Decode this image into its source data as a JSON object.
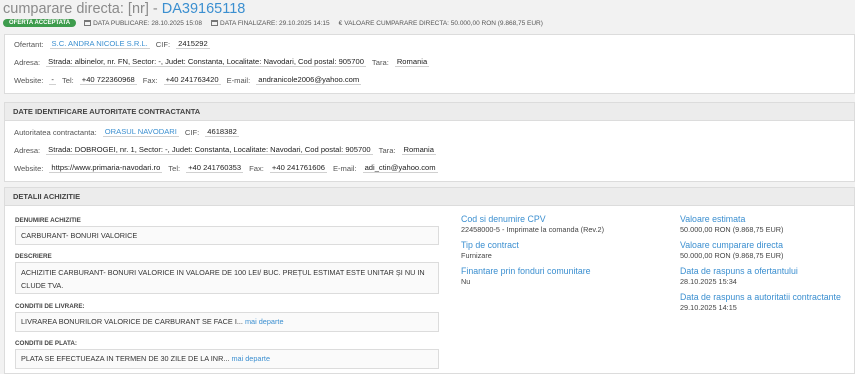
{
  "header": {
    "title_prefix": "cumparare directa: [nr] - ",
    "title_code": "DA39165118",
    "badge": "OFERTA ACCEPTATA",
    "data_publicare": "DATA PUBLICARE: 28.10.2025 15:08",
    "data_finalizare": "DATA FINALIZARE: 29.10.2025 14:15",
    "valoare": "VALOARE CUMPARARE DIRECTA: 50.000,00   RON (9.868,75  EUR)"
  },
  "ofertant": {
    "label_ofertant": "Ofertant:",
    "name": "S.C. ANDRA NICOLE S.R.L.",
    "label_cif": "CIF:",
    "cif": "2415292",
    "label_adresa": "Adresa:",
    "adresa": "Strada: albinelor, nr. FN, Sector: -, Judet: Constanta, Localitate: Navodari, Cod postal: 905700",
    "label_tara": "Tara:",
    "tara": "Romania",
    "label_website": "Website:",
    "website": "-",
    "label_tel": "Tel:",
    "tel": "+40 722360968",
    "label_fax": "Fax:",
    "fax": "+40 241763420",
    "label_email": "E-mail:",
    "email": "andranicole2006@yahoo.com"
  },
  "autoritate": {
    "section_title": "DATE IDENTIFICARE AUTORITATE CONTRACTANTA",
    "label_autoritate": "Autoritatea contractanta:",
    "name": "ORASUL NAVODARI",
    "label_cif": "CIF:",
    "cif": "4618382",
    "label_adresa": "Adresa:",
    "adresa": "Strada: DOBROGEI, nr. 1, Sector: -, Judet: Constanta, Localitate: Navodari, Cod postal: 905700",
    "label_tara": "Tara:",
    "tara": "Romania",
    "label_website": "Website:",
    "website": "https://www.primaria-navodari.ro",
    "label_tel": "Tel:",
    "tel": "+40 241760353",
    "label_fax": "Fax:",
    "fax": "+40 241761606",
    "label_email": "E-mail:",
    "email": "adi_ctin@yahoo.com"
  },
  "detalii": {
    "section_title": "DETALII ACHIZITIE",
    "denumire_label": "DENUMIRE ACHIZITIE",
    "denumire": "CARBURANT- BONURI VALORICE",
    "descriere_label": "DESCRIERE",
    "descriere_line1": "ACHIZITIE CARBURANT- BONURI VALORICE IN VALOARE DE 100 LEI/ BUC. PREȚUL ESTIMAT ESTE UNITAR ȘI NU IN",
    "descriere_line2": "CLUDE TVA.",
    "livrare_label": "CONDITII DE LIVRARE:",
    "livrare": "LIVRAREA BONURILOR VALORICE DE CARBURANT SE FACE I...",
    "plata_label": "CONDITII DE PLATA:",
    "plata": "PLATA SE EFECTUEAZA IN TERMEN DE 30 ZILE DE LA INR...",
    "more": "mai departe",
    "cpv_h": "Cod si denumire CPV",
    "cpv_v": "22458000-5 - Imprimate la comanda (Rev.2)",
    "tip_h": "Tip de contract",
    "tip_v": "Furnizare",
    "fin_h": "Finantare prin fonduri comunitare",
    "fin_v": "Nu",
    "val_est_h": "Valoare estimata",
    "val_est_v": "50.000,00  RON (9.868,75  EUR)",
    "val_cd_h": "Valoare cumparare directa",
    "val_cd_v": "50.000,00  RON (9.868,75  EUR)",
    "rasp_of_h": "Data de raspuns a ofertantului",
    "rasp_of_v": "28.10.2025 15:34",
    "rasp_ac_h": "Data de raspuns a autoritatii contractante",
    "rasp_ac_v": "29.10.2025 14:15"
  }
}
